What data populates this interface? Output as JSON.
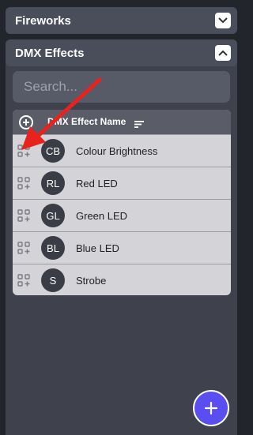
{
  "fireworks": {
    "title": "Fireworks",
    "expanded": false
  },
  "dmx": {
    "title": "DMX Effects",
    "expanded": true,
    "search": {
      "placeholder": "Search...",
      "value": ""
    },
    "table": {
      "column": "DMX Effect Name",
      "rows": [
        {
          "initials": "CB",
          "name": "Colour Brightness"
        },
        {
          "initials": "RL",
          "name": "Red LED"
        },
        {
          "initials": "GL",
          "name": "Green LED"
        },
        {
          "initials": "BL",
          "name": "Blue LED"
        },
        {
          "initials": "S",
          "name": "Strobe"
        }
      ]
    }
  },
  "colors": {
    "accent": "#5b4ef0",
    "annotation": "#e8231d",
    "panel": "#3f424c"
  }
}
